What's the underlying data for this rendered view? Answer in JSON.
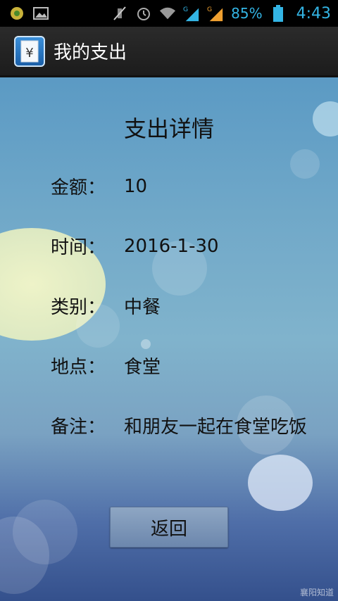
{
  "status_bar": {
    "battery": "85%",
    "time": "4:43",
    "left_icons": [
      "app-notification-icon",
      "image-icon"
    ],
    "right_icons": [
      "mute-icon",
      "alarm-icon",
      "wifi-icon",
      "signal-g-icon",
      "signal-g2-icon",
      "battery-icon"
    ]
  },
  "app_bar": {
    "title": "我的支出",
    "icon": "yen-document-icon"
  },
  "detail": {
    "title": "支出详情",
    "amount_label": "金额：",
    "amount_value": "10",
    "time_label": "时间：",
    "time_value": "2016-1-30",
    "category_label": "类别：",
    "category_value": "中餐",
    "location_label": "地点：",
    "location_value": "食堂",
    "note_label": "备注：",
    "note_value": "和朋友一起在食堂吃饭"
  },
  "back_button": "返回",
  "watermark": "襄阳知道",
  "colors": {
    "status_accent": "#33b5e5",
    "action_bar": "#222222",
    "background_top": "#5b9ac4",
    "background_bottom": "#34508c"
  }
}
